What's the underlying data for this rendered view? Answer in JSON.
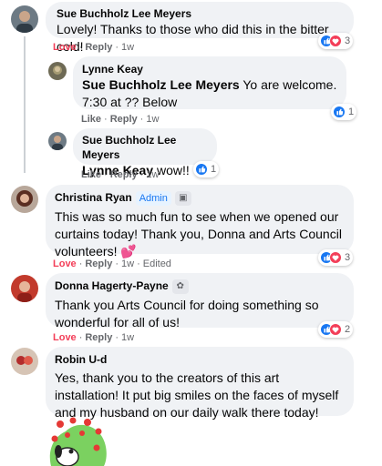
{
  "actions": {
    "love": "Love",
    "like": "Like",
    "reply": "Reply",
    "edited": "Edited",
    "admin": "Admin"
  },
  "comments": [
    {
      "author": "Sue Buchholz Lee Meyers",
      "text": "Lovely! Thanks to those who did this in the bitter cold!",
      "reaction": "Love",
      "time": "1w",
      "count": "3"
    },
    {
      "author": "Lynne Keay",
      "mention": "Sue Buchholz Lee Meyers",
      "text": " Yo are welcome. 7:30 at ?? Below",
      "reaction": "Like",
      "time": "1w",
      "count": "1"
    },
    {
      "author": "Sue Buchholz Lee Meyers",
      "mention": "Lynne Keay",
      "text": " wow!!",
      "reaction": "Like",
      "time": "1w",
      "count": "1"
    },
    {
      "author": "Christina Ryan",
      "badge": "Admin",
      "text": "This was so much fun to see when we opened our curtains today! Thank you, Donna and Arts Council volunteers! 💕",
      "reaction": "Love",
      "time": "1w",
      "edited": "Edited",
      "count": "3"
    },
    {
      "author": "Donna Hagerty-Payne",
      "text": "Thank you Arts Council for doing something so wonderful for all of us!",
      "reaction": "Love",
      "time": "1w",
      "count": "2"
    },
    {
      "author": "Robin U-d",
      "text": "Yes, thank you to the creators of this art installation! It put big smiles on the faces of myself and my husband on our daily walk there today!"
    }
  ],
  "colors": {
    "bubble": "#f0f2f5",
    "meta": "#65676b",
    "love": "#f33e58",
    "like": "#1877f2"
  }
}
